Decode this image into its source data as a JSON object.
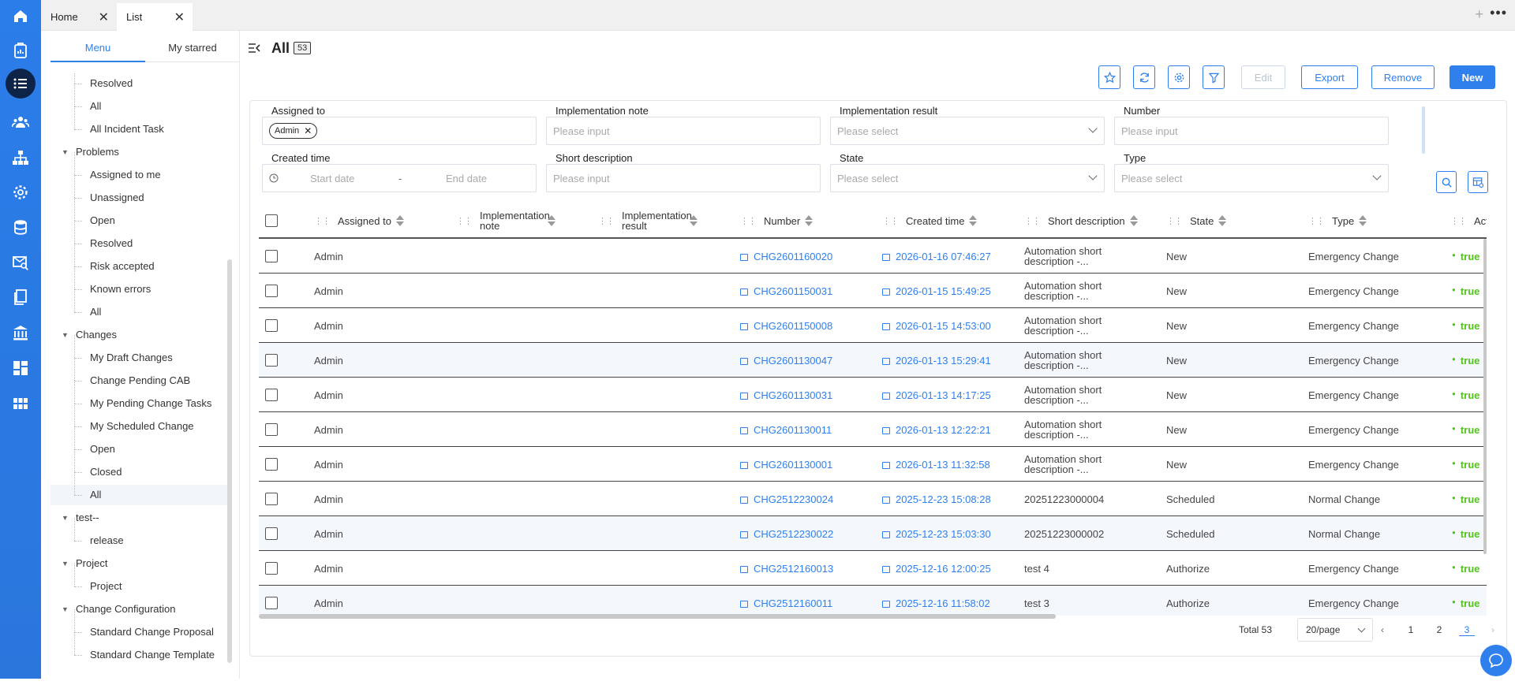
{
  "colors": {
    "accent": "#2f80ed",
    "rail": "#2b7de9",
    "rail_active": "#0d2347",
    "active_true": "#52c41a"
  },
  "rail": {
    "icons": [
      "home-icon",
      "clipboard-report-icon",
      "list-icon",
      "users-icon",
      "org-chart-icon",
      "settings-icon",
      "database-icon",
      "search-mail-icon",
      "documents-icon",
      "bank-icon",
      "dashboard-icon",
      "grid-icon"
    ],
    "active": "list-icon"
  },
  "tabs": [
    {
      "label": "Home"
    },
    {
      "label": "List"
    }
  ],
  "topbar": {
    "plus": "+",
    "more": "•••"
  },
  "menu": {
    "tabs": [
      "Menu",
      "My starred"
    ],
    "active_tab": "Menu",
    "tree": [
      {
        "label": "Resolved",
        "type": "leaf"
      },
      {
        "label": "All",
        "type": "leaf"
      },
      {
        "label": "All Incident Task",
        "type": "leaf"
      },
      {
        "label": "Problems",
        "type": "group"
      },
      {
        "label": "Assigned to me",
        "type": "leaf"
      },
      {
        "label": "Unassigned",
        "type": "leaf"
      },
      {
        "label": "Open",
        "type": "leaf"
      },
      {
        "label": "Resolved",
        "type": "leaf"
      },
      {
        "label": "Risk accepted",
        "type": "leaf"
      },
      {
        "label": "Known errors",
        "type": "leaf"
      },
      {
        "label": "All",
        "type": "leaf"
      },
      {
        "label": "Changes",
        "type": "group"
      },
      {
        "label": "My Draft Changes",
        "type": "leaf"
      },
      {
        "label": "Change Pending CAB",
        "type": "leaf"
      },
      {
        "label": "My Pending Change Tasks",
        "type": "leaf"
      },
      {
        "label": "My Scheduled Change",
        "type": "leaf"
      },
      {
        "label": "Open",
        "type": "leaf"
      },
      {
        "label": "Closed",
        "type": "leaf"
      },
      {
        "label": "All",
        "type": "leaf",
        "selected": true
      },
      {
        "label": "test--",
        "type": "group"
      },
      {
        "label": "release",
        "type": "leaf"
      },
      {
        "label": "Project",
        "type": "group"
      },
      {
        "label": "Project",
        "type": "leaf"
      },
      {
        "label": "Change Configuration",
        "type": "group"
      },
      {
        "label": "Standard Change Proposal",
        "type": "leaf"
      },
      {
        "label": "Standard Change Template",
        "type": "leaf"
      }
    ]
  },
  "header": {
    "title": "All",
    "count": "53"
  },
  "toolbar": {
    "icon_buttons": [
      "star-icon",
      "refresh-icon",
      "settings-icon",
      "filter-icon"
    ],
    "edit_label": "Edit",
    "export_label": "Export",
    "remove_label": "Remove",
    "new_label": "New"
  },
  "filters": {
    "assigned_to": {
      "label": "Assigned to",
      "tag": "Admin"
    },
    "implementation_note": {
      "label": "Implementation note",
      "placeholder": "Please input"
    },
    "implementation_result": {
      "label": "Implementation result",
      "placeholder": "Please select"
    },
    "number": {
      "label": "Number",
      "placeholder": "Please input"
    },
    "created_time": {
      "label": "Created time",
      "start": "Start date",
      "sep": "-",
      "end": "End date"
    },
    "short_description": {
      "label": "Short description",
      "placeholder": "Please input"
    },
    "state": {
      "label": "State",
      "placeholder": "Please select"
    },
    "type": {
      "label": "Type",
      "placeholder": "Please select"
    }
  },
  "table": {
    "columns": [
      "Assigned to",
      "Implementation note",
      "Implementation result",
      "Number",
      "Created time",
      "Short description",
      "State",
      "Type",
      "Activ"
    ],
    "rows": [
      {
        "assigned": "Admin",
        "number": "CHG2601160020",
        "created": "2026-01-16 07:46:27",
        "desc": "Automation short description -...",
        "state": "New",
        "type": "Emergency Change",
        "active": "true"
      },
      {
        "assigned": "Admin",
        "number": "CHG2601150031",
        "created": "2026-01-15 15:49:25",
        "desc": "Automation short description -...",
        "state": "New",
        "type": "Emergency Change",
        "active": "true"
      },
      {
        "assigned": "Admin",
        "number": "CHG2601150008",
        "created": "2026-01-15 14:53:00",
        "desc": "Automation short description -...",
        "state": "New",
        "type": "Emergency Change",
        "active": "true"
      },
      {
        "assigned": "Admin",
        "number": "CHG2601130047",
        "created": "2026-01-13 15:29:41",
        "desc": "Automation short description -...",
        "state": "New",
        "type": "Emergency Change",
        "active": "true"
      },
      {
        "assigned": "Admin",
        "number": "CHG2601130031",
        "created": "2026-01-13 14:17:25",
        "desc": "Automation short description -...",
        "state": "New",
        "type": "Emergency Change",
        "active": "true"
      },
      {
        "assigned": "Admin",
        "number": "CHG2601130011",
        "created": "2026-01-13 12:22:21",
        "desc": "Automation short description -...",
        "state": "New",
        "type": "Emergency Change",
        "active": "true"
      },
      {
        "assigned": "Admin",
        "number": "CHG2601130001",
        "created": "2026-01-13 11:32:58",
        "desc": "Automation short description -...",
        "state": "New",
        "type": "Emergency Change",
        "active": "true"
      },
      {
        "assigned": "Admin",
        "number": "CHG2512230024",
        "created": "2025-12-23 15:08:28",
        "desc": "20251223000004",
        "state": "Scheduled",
        "type": "Normal Change",
        "active": "true"
      },
      {
        "assigned": "Admin",
        "number": "CHG2512230022",
        "created": "2025-12-23 15:03:30",
        "desc": "20251223000002",
        "state": "Scheduled",
        "type": "Normal Change",
        "active": "true"
      },
      {
        "assigned": "Admin",
        "number": "CHG2512160013",
        "created": "2025-12-16 12:00:25",
        "desc": "test 4",
        "state": "Authorize",
        "type": "Emergency Change",
        "active": "true"
      },
      {
        "assigned": "Admin",
        "number": "CHG2512160011",
        "created": "2025-12-16 11:58:02",
        "desc": "test 3",
        "state": "Authorize",
        "type": "Emergency Change",
        "active": "true"
      }
    ]
  },
  "pagination": {
    "total": "Total 53",
    "page_size": "20/page",
    "pages": [
      "1",
      "2",
      "3"
    ],
    "current": "3"
  }
}
